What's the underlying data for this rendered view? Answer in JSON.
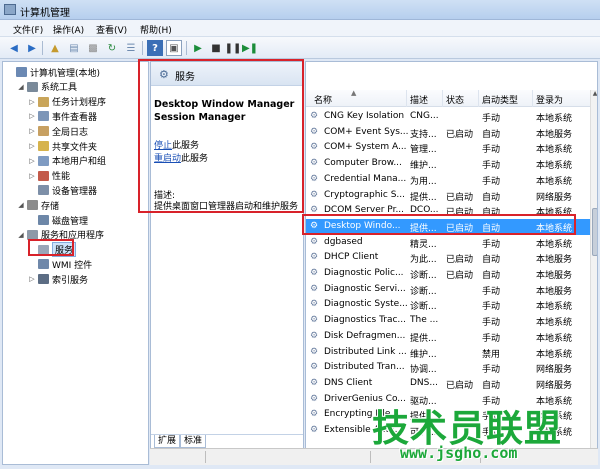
{
  "window": {
    "title": "计算机管理"
  },
  "menubar": [
    {
      "label": "文件(F)"
    },
    {
      "label": "操作(A)"
    },
    {
      "label": "查看(V)"
    },
    {
      "label": "帮助(H)"
    }
  ],
  "toolbar": {
    "icons": [
      "back-icon",
      "forward-icon",
      "up-folder-icon",
      "properties-icon",
      "export-icon",
      "refresh-icon",
      "list-icon",
      "help-icon",
      "view-icon",
      "play-icon",
      "stop-icon",
      "pause-icon",
      "restart-icon"
    ]
  },
  "tree": [
    {
      "label": "计算机管理(本地)",
      "level": 0,
      "exp": "",
      "icon_color": "#6b89b3"
    },
    {
      "label": "系统工具",
      "level": 1,
      "exp": "◢",
      "icon_color": "#7a8a9a"
    },
    {
      "label": "任务计划程序",
      "level": 2,
      "exp": "▷",
      "icon_color": "#c9a55a"
    },
    {
      "label": "事件查看器",
      "level": 2,
      "exp": "▷",
      "icon_color": "#7d96b8"
    },
    {
      "label": "全局日志",
      "level": 2,
      "exp": "▷",
      "icon_color": "#c7a062"
    },
    {
      "label": "共享文件夹",
      "level": 2,
      "exp": "▷",
      "icon_color": "#d6b34d"
    },
    {
      "label": "本地用户和组",
      "level": 2,
      "exp": "▷",
      "icon_color": "#7f9bc2"
    },
    {
      "label": "性能",
      "level": 2,
      "exp": "▷",
      "icon_color": "#c35a4a"
    },
    {
      "label": "设备管理器",
      "level": 2,
      "exp": "",
      "icon_color": "#7d8fa8"
    },
    {
      "label": "存储",
      "level": 1,
      "exp": "◢",
      "icon_color": "#8c8c8c"
    },
    {
      "label": "磁盘管理",
      "level": 2,
      "exp": "",
      "icon_color": "#6d87a8"
    },
    {
      "label": "服务和应用程序",
      "level": 1,
      "exp": "◢",
      "icon_color": "#8d99a8"
    },
    {
      "label": "服务",
      "level": 2,
      "exp": "",
      "icon_color": "#9aa6b8",
      "selected": true
    },
    {
      "label": "WMI 控件",
      "level": 2,
      "exp": "",
      "icon_color": "#6f88aa"
    },
    {
      "label": "索引服务",
      "level": 2,
      "exp": "▷",
      "icon_color": "#5c6d84"
    }
  ],
  "mid": {
    "header": "服务",
    "service_name": "Desktop Window Manager Session Manager",
    "stop_link": "停止",
    "stop_suffix": "此服务",
    "restart_link": "重启动",
    "restart_suffix": "此服务",
    "desc_label": "描述:",
    "description": "提供桌面窗口管理器启动和维护服务",
    "tabs": [
      "扩展",
      "标准"
    ]
  },
  "columns": [
    "名称",
    "描述",
    "状态",
    "启动类型",
    "登录为"
  ],
  "rows": [
    [
      "CNG Key Isolation",
      "CNG...",
      "",
      "手动",
      "本地系统"
    ],
    [
      "COM+ Event Sys...",
      "支持...",
      "已启动",
      "自动",
      "本地服务"
    ],
    [
      "COM+ System A...",
      "管理...",
      "",
      "手动",
      "本地系统"
    ],
    [
      "Computer Brow...",
      "维护...",
      "",
      "手动",
      "本地系统"
    ],
    [
      "Credential Mana...",
      "为用...",
      "",
      "手动",
      "本地系统"
    ],
    [
      "Cryptographic S...",
      "提供...",
      "已启动",
      "自动",
      "网络服务"
    ],
    [
      "DCOM Server Pr...",
      "DCO...",
      "已启动",
      "自动",
      "本地系统"
    ],
    [
      "Desktop Windo...",
      "提供...",
      "已启动",
      "自动",
      "本地系统"
    ],
    [
      "dgbased",
      "精灵...",
      "",
      "手动",
      "本地系统"
    ],
    [
      "DHCP Client",
      "为此...",
      "已启动",
      "自动",
      "本地服务"
    ],
    [
      "Diagnostic Polic...",
      "诊断...",
      "已启动",
      "自动",
      "本地服务"
    ],
    [
      "Diagnostic Servi...",
      "诊断...",
      "",
      "手动",
      "本地服务"
    ],
    [
      "Diagnostic Syste...",
      "诊断...",
      "",
      "手动",
      "本地系统"
    ],
    [
      "Diagnostics Trac...",
      "The ...",
      "",
      "手动",
      "本地系统"
    ],
    [
      "Disk Defragmen...",
      "提供...",
      "",
      "手动",
      "本地系统"
    ],
    [
      "Distributed Link ...",
      "维护...",
      "",
      "禁用",
      "本地系统"
    ],
    [
      "Distributed Tran...",
      "协调...",
      "",
      "手动",
      "网络服务"
    ],
    [
      "DNS Client",
      "DNS...",
      "已启动",
      "自动",
      "网络服务"
    ],
    [
      "DriverGenius Co...",
      "驱动...",
      "",
      "手动",
      "本地系统"
    ],
    [
      "Encrypting File...",
      "提供...",
      "",
      "手动",
      "本地系统"
    ],
    [
      "Extensible Auth...",
      "可扩...",
      "",
      "手动",
      "本地系统"
    ]
  ],
  "selected_row": 7,
  "watermark": {
    "text": "技术员联盟",
    "url": "www.jsgho.com"
  },
  "colors": {
    "accent": "#3399ff",
    "highlight_box": "#d8222a",
    "watermark": "#1ca83a"
  }
}
